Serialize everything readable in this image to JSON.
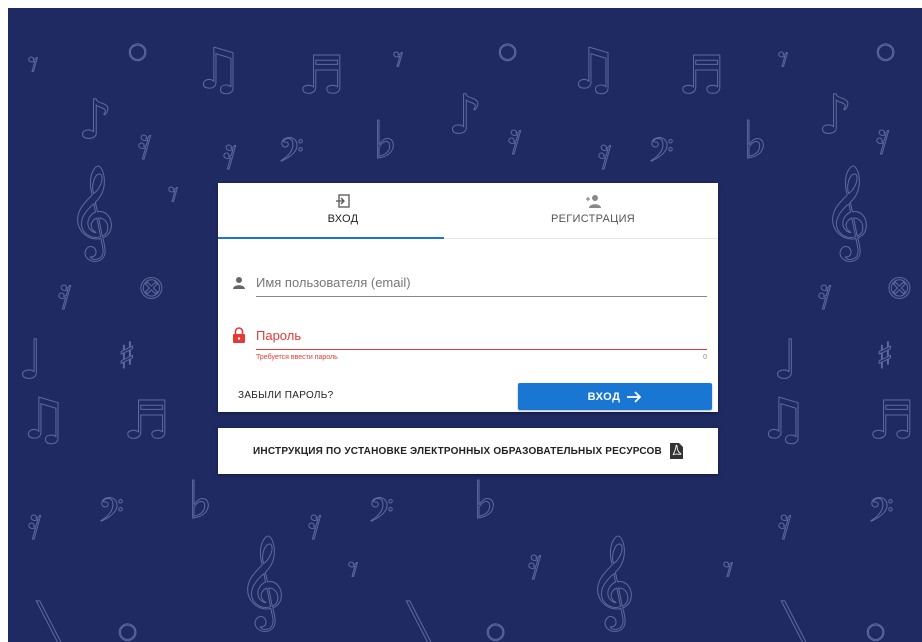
{
  "tabs": [
    {
      "label": "ВХОД",
      "icon": "login-icon",
      "active": true
    },
    {
      "label": "РЕГИСТРАЦИЯ",
      "icon": "person-add-icon",
      "active": false
    }
  ],
  "form": {
    "email_placeholder": "Имя пользователя (email)",
    "email_value": "",
    "password_placeholder": "Пароль",
    "password_value": "",
    "password_error": "Требуется ввести пароль",
    "password_char_count": "0"
  },
  "actions": {
    "forgot_label": "ЗАБЫЛИ ПАРОЛЬ?",
    "login_label": "ВХОД"
  },
  "instructions": {
    "label": "ИНСТРУКЦИЯ ПО УСТАНОВКЕ ЭЛЕКТРОННЫХ ОБРАЗОВАТЕЛЬНЫХ РЕСУРСОВ",
    "icon": "pdf-icon"
  },
  "colors": {
    "background": "#1f2a63",
    "pattern": "#5e6a9c",
    "primary": "#1976d2",
    "error": "#e53935"
  }
}
